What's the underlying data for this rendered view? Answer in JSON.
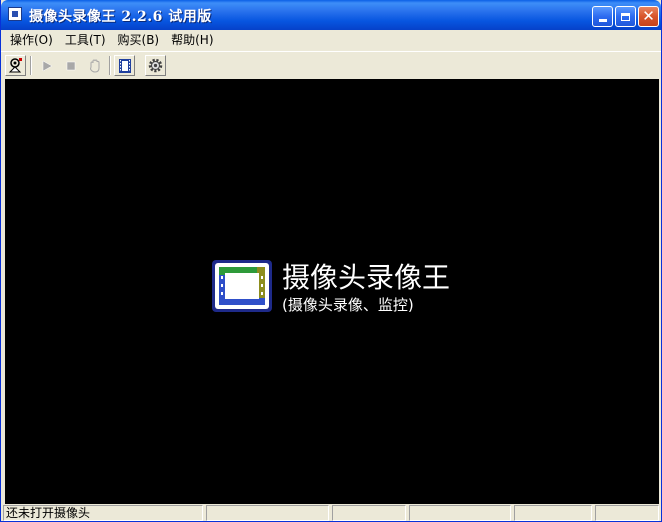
{
  "window": {
    "title": "摄像头录像王 2.2.6 试用版"
  },
  "menu": {
    "items": [
      {
        "label": "操作(O)"
      },
      {
        "label": "工具(T)"
      },
      {
        "label": "购买(B)"
      },
      {
        "label": "帮助(H)"
      }
    ]
  },
  "toolbar": {
    "buttons": [
      {
        "icon": "camera-connect-icon",
        "enabled": true
      },
      {
        "icon": "play-icon",
        "enabled": false
      },
      {
        "icon": "stop-icon",
        "enabled": false
      },
      {
        "icon": "hand-icon",
        "enabled": false
      },
      {
        "icon": "film-icon",
        "enabled": true
      },
      {
        "icon": "gear-icon",
        "enabled": true
      }
    ]
  },
  "splash": {
    "name": "摄像头录像王",
    "subtitle": "(摄像头录像、监控)"
  },
  "status": {
    "message": "还未打开摄像头",
    "panels": [
      "",
      "",
      "",
      "",
      ""
    ]
  },
  "colors": {
    "titlebar": "#0755E0",
    "video_bg": "#000000",
    "chrome": "#ECE9D8"
  }
}
